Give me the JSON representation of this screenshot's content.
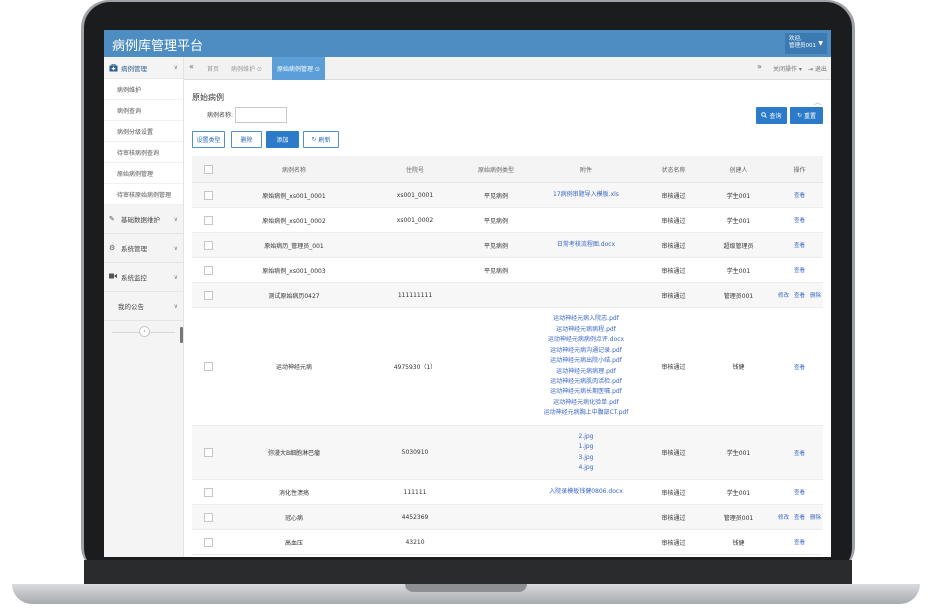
{
  "app": {
    "title": "病例库管理平台",
    "user_greeting": "欢迎,",
    "user_name": "管理员001"
  },
  "sidebar": {
    "head": {
      "label": "病例管理"
    },
    "sub_items": [
      {
        "label": "病例维护"
      },
      {
        "label": "病例查询"
      },
      {
        "label": "病例分级设置"
      },
      {
        "label": "待审核病例查询"
      },
      {
        "label": "原始病例管理"
      },
      {
        "label": "待审核原始病例管理"
      }
    ],
    "groups": [
      {
        "label": "基础数据维护"
      },
      {
        "label": "系统管理"
      },
      {
        "label": "系统监控"
      },
      {
        "label": "我的公告"
      }
    ]
  },
  "tabs": {
    "items": [
      {
        "label": "首页"
      },
      {
        "label": "病例维护 ⊙"
      },
      {
        "label": "原始病例管理 ⊙"
      }
    ],
    "close_ops": "关闭操作 ▾",
    "logout": "⇥ 退出"
  },
  "search": {
    "section_title": "原始病例",
    "name_label": "病例名称:",
    "name_value": "",
    "query_label": "查询",
    "reset_label": "重置"
  },
  "toolbar": {
    "set_type": "设置类型",
    "delete": "删除",
    "add": "添加",
    "refresh": "刷新"
  },
  "table": {
    "headers": [
      "病例名称",
      "住院号",
      "原始病例类型",
      "附件",
      "状态名称",
      "创建人",
      "操作"
    ],
    "rows": [
      {
        "name": "原始病例_xs001_0001",
        "pid": "xs001_0001",
        "type": "平见病例",
        "attachments": [
          "17病例审题导入模板.xls"
        ],
        "state": "审核通过",
        "creator": "学生001",
        "ops": [
          "查看"
        ]
      },
      {
        "name": "原始病例_xs001_0002",
        "pid": "xs001_0002",
        "type": "平见病例",
        "attachments": [],
        "state": "审核通过",
        "creator": "学生001",
        "ops": [
          "查看"
        ]
      },
      {
        "name": "原始病历_管理员_001",
        "pid": "",
        "type": "平见病例",
        "attachments": [
          "日常考核流程图.docx"
        ],
        "state": "审核通过",
        "creator": "超级管理员",
        "ops": [
          "查看"
        ]
      },
      {
        "name": "原始病例_xs001_0003",
        "pid": "",
        "type": "平见病例",
        "attachments": [],
        "state": "审核通过",
        "creator": "学生001",
        "ops": [
          "查看"
        ]
      },
      {
        "name": "测试原始病历0427",
        "pid": "111111111",
        "type": "",
        "attachments": [],
        "state": "审核通过",
        "creator": "管理员001",
        "ops": [
          "修改",
          "查看",
          "删除"
        ]
      },
      {
        "name": "运动神经元病",
        "pid": "4975930（1）",
        "type": "",
        "attachments": [
          "运动神经元病入院志.pdf",
          "运动神经元病病程.pdf",
          "运动神经元病病例点评.docx",
          "运动神经元病沟通记录.pdf",
          "运动神经元病出院小结.pdf",
          "运动神经元病病理.pdf",
          "运动神经元病肌肉活检.pdf",
          "运动神经元病长期医嘱.pdf",
          "运动神经元病化验单.pdf",
          "运动神经元病胸上中腹部CT.pdf"
        ],
        "state": "审核通过",
        "creator": "钱健",
        "ops": [
          "查看"
        ]
      },
      {
        "name": "弥漫大B细胞淋巴瘤",
        "pid": "5030910",
        "type": "",
        "attachments": [
          "2.jpg",
          "1.jpg",
          "3.jpg",
          "4.jpg"
        ],
        "state": "审核通过",
        "creator": "学生001",
        "ops": [
          "查看"
        ]
      },
      {
        "name": "消化性溃疡",
        "pid": "111111",
        "type": "",
        "attachments": [
          "入院录模板钱健0806.docx"
        ],
        "state": "审核通过",
        "creator": "学生001",
        "ops": [
          "查看"
        ]
      },
      {
        "name": "冠心病",
        "pid": "4452369",
        "type": "",
        "attachments": [],
        "state": "审核通过",
        "creator": "管理员001",
        "ops": [
          "修改",
          "查看",
          "删除"
        ]
      },
      {
        "name": "高血压",
        "pid": "43210",
        "type": "",
        "attachments": [],
        "state": "审核通过",
        "creator": "钱健",
        "ops": [
          "查看"
        ]
      }
    ]
  }
}
